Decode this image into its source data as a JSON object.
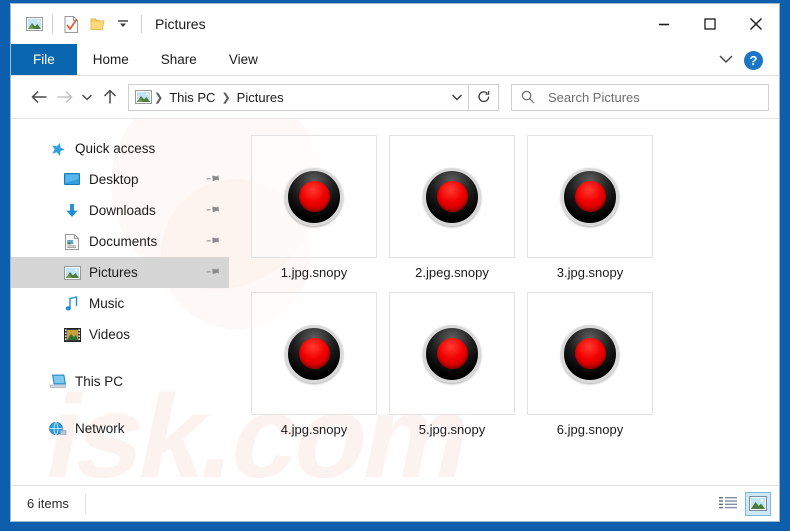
{
  "window": {
    "title": "Pictures",
    "quick_access_icons": [
      "picture-icon",
      "checkmark-document-icon",
      "folder-icon",
      "dropdown-arrow-icon"
    ],
    "controls": {
      "minimize": "—",
      "maximize": "□",
      "close": "✕"
    }
  },
  "ribbon": {
    "tabs": [
      {
        "label": "File",
        "active": true
      },
      {
        "label": "Home",
        "active": false
      },
      {
        "label": "Share",
        "active": false
      },
      {
        "label": "View",
        "active": false
      }
    ],
    "collapse_icon": "chevron-down-icon",
    "help_label": "?"
  },
  "address": {
    "back_icon": "←",
    "forward_icon": "→",
    "recent_icon": "⌄",
    "up_icon": "↑",
    "path_icon": "picture-icon",
    "crumbs": [
      "This PC",
      "Pictures"
    ],
    "separator": "❯",
    "dropdown_icon": "⌄",
    "refresh_icon": "↻"
  },
  "search": {
    "icon": "search-icon",
    "placeholder": "Search Pictures",
    "value": ""
  },
  "sidebar": {
    "items": [
      {
        "label": "Quick access",
        "icon": "star-icon",
        "pinned": false,
        "selected": false,
        "indent": false
      },
      {
        "label": "Desktop",
        "icon": "desktop-icon",
        "pinned": true,
        "selected": false,
        "indent": true
      },
      {
        "label": "Downloads",
        "icon": "download-icon",
        "pinned": true,
        "selected": false,
        "indent": true
      },
      {
        "label": "Documents",
        "icon": "document-icon",
        "pinned": true,
        "selected": false,
        "indent": true
      },
      {
        "label": "Pictures",
        "icon": "picture-icon",
        "pinned": true,
        "selected": true,
        "indent": true
      },
      {
        "label": "Music",
        "icon": "music-note-icon",
        "pinned": false,
        "selected": false,
        "indent": true
      },
      {
        "label": "Videos",
        "icon": "video-icon",
        "pinned": false,
        "selected": false,
        "indent": true
      },
      {
        "label": "This PC",
        "icon": "computer-icon",
        "pinned": false,
        "selected": false,
        "indent": false
      },
      {
        "label": "Network",
        "icon": "network-icon",
        "pinned": false,
        "selected": false,
        "indent": false
      }
    ],
    "pin_glyph": "📌"
  },
  "files": [
    {
      "name": "1.jpg.snopy",
      "icon": "snopy-ransomware-icon"
    },
    {
      "name": "2.jpeg.snopy",
      "icon": "snopy-ransomware-icon"
    },
    {
      "name": "3.jpg.snopy",
      "icon": "snopy-ransomware-icon"
    },
    {
      "name": "4.jpg.snopy",
      "icon": "snopy-ransomware-icon"
    },
    {
      "name": "5.jpg.snopy",
      "icon": "snopy-ransomware-icon"
    },
    {
      "name": "6.jpg.snopy",
      "icon": "snopy-ransomware-icon"
    }
  ],
  "status": {
    "item_count": "6 items",
    "details_view_icon": "details-view-icon",
    "large_icons_view_icon": "large-icons-view-icon"
  },
  "watermark": {
    "text": "isk.com"
  },
  "colors": {
    "accent": "#0b66b0",
    "desktop": "#0d5ead",
    "selection": "#d6d6d6",
    "snopy_red": "#f00000"
  }
}
